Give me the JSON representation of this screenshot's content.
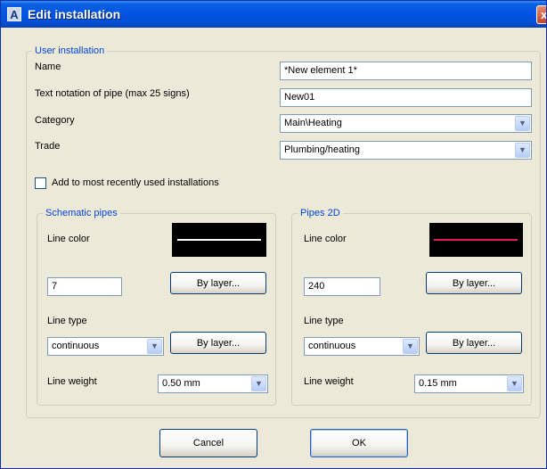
{
  "window": {
    "title": "Edit installation",
    "close_glyph": "x",
    "app_icon_glyph": "A"
  },
  "user_installation": {
    "legend": "User installation",
    "name_label": "Name",
    "name_value": "*New element 1*",
    "text_notation_label": "Text notation of pipe (max 25 signs)",
    "text_notation_value": "New01",
    "category_label": "Category",
    "category_value": "Main\\Heating",
    "trade_label": "Trade",
    "trade_value": "Plumbing/heating"
  },
  "recent_checkbox": {
    "label": "Add to most recently used installations",
    "checked": false
  },
  "schematic_pipes": {
    "legend": "Schematic pipes",
    "line_color_label": "Line color",
    "line_color_swatch": "#ffffff",
    "color_value": "7",
    "by_layer_color_label": "By layer...",
    "line_type_label": "Line type",
    "line_type_value": "continuous",
    "by_layer_type_label": "By layer...",
    "line_weight_label": "Line weight",
    "line_weight_value": "0.50 mm"
  },
  "pipes_2d": {
    "legend": "Pipes 2D",
    "line_color_label": "Line color",
    "line_color_swatch": "#e8195a",
    "color_value": "240",
    "by_layer_color_label": "By layer...",
    "line_type_label": "Line type",
    "line_type_value": "continuous",
    "by_layer_type_label": "By layer...",
    "line_weight_label": "Line weight",
    "line_weight_value": "0.15 mm"
  },
  "footer": {
    "cancel_label": "Cancel",
    "ok_label": "OK"
  },
  "icons": {
    "dropdown_arrow": "chevron-down-icon",
    "close": "close-icon"
  }
}
